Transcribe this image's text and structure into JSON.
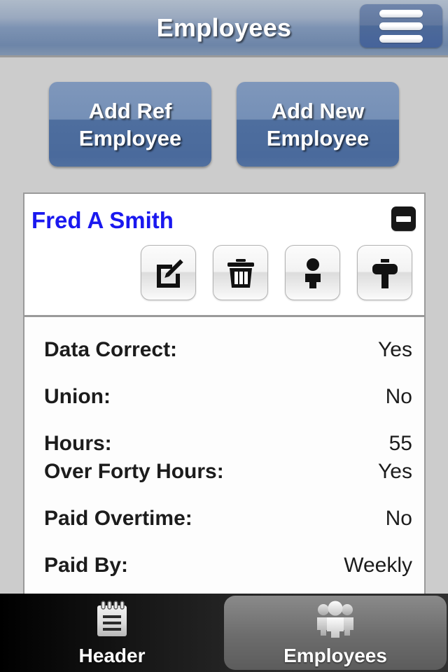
{
  "header": {
    "title": "Employees",
    "menu_icon": "hamburger-menu-icon"
  },
  "actions": {
    "add_ref_employee": "Add Ref Employee",
    "add_new_employee": "Add New Employee"
  },
  "employee_card": {
    "name": "Fred A Smith",
    "collapse_icon": "minus-collapse-icon",
    "tools": [
      {
        "name": "edit-icon",
        "label": "Edit"
      },
      {
        "name": "trash-icon",
        "label": "Delete"
      },
      {
        "name": "person-icon",
        "label": "Person"
      },
      {
        "name": "hammer-icon",
        "label": "Tools"
      }
    ],
    "fields": [
      {
        "label": "Data Correct:",
        "value": "Yes"
      },
      {
        "label": "Union:",
        "value": "No"
      },
      {
        "label": "Hours:",
        "value": "55"
      },
      {
        "label": "Over Forty Hours:",
        "value": "Yes"
      },
      {
        "label": "Paid Overtime:",
        "value": "No"
      },
      {
        "label": "Paid By:",
        "value": "Weekly"
      }
    ]
  },
  "tabbar": {
    "tabs": [
      {
        "label": "Header",
        "icon": "notepad-icon",
        "active": false
      },
      {
        "label": "Employees",
        "icon": "people-group-icon",
        "active": true
      }
    ]
  },
  "colors": {
    "page_background": "#cccccc",
    "header_blue": "#7d93b3",
    "button_blue": "#4e6e9e",
    "name_blue": "#1a18ef",
    "card_background": "#fdfdfd",
    "tabbar_dark": "#151515",
    "active_tab_gray": "#6c6c6c"
  }
}
